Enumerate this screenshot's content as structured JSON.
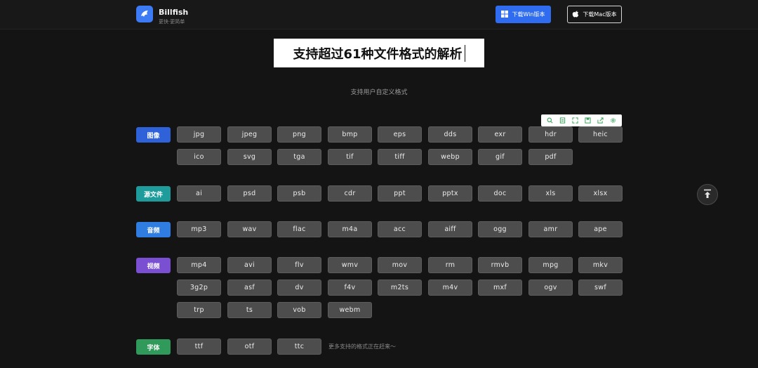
{
  "header": {
    "brand_name": "Billfish",
    "brand_tagline": "更快·更简单",
    "win_button": "下载Win版本",
    "mac_button": "下载Mac版本"
  },
  "hero": {
    "title": "支持超过61种文件格式的解析",
    "subtitle": "支持用户自定义格式"
  },
  "toolbar_icons": [
    "zoom-icon",
    "document-icon",
    "expand-icon",
    "save-icon",
    "share-icon",
    "settings-icon"
  ],
  "categories": [
    {
      "label": "图像",
      "color": "#2f62d8",
      "formats": [
        "jpg",
        "jpeg",
        "png",
        "bmp",
        "eps",
        "dds",
        "exr",
        "hdr",
        "heic",
        "ico",
        "svg",
        "tga",
        "tif",
        "tiff",
        "webp",
        "gif",
        "pdf"
      ]
    },
    {
      "label": "源文件",
      "color": "#1e9b9b",
      "formats": [
        "ai",
        "psd",
        "psb",
        "cdr",
        "ppt",
        "pptx",
        "doc",
        "xls",
        "xlsx"
      ]
    },
    {
      "label": "音频",
      "color": "#2f7de0",
      "formats": [
        "mp3",
        "wav",
        "flac",
        "m4a",
        "acc",
        "aiff",
        "ogg",
        "amr",
        "ape"
      ]
    },
    {
      "label": "视频",
      "color": "#7a4fd1",
      "formats": [
        "mp4",
        "avi",
        "flv",
        "wmv",
        "mov",
        "rm",
        "rmvb",
        "mpg",
        "mkv",
        "3g2p",
        "asf",
        "dv",
        "f4v",
        "m2ts",
        "m4v",
        "mxf",
        "ogv",
        "swf",
        "trp",
        "ts",
        "vob",
        "webm"
      ]
    },
    {
      "label": "字体",
      "color": "#2f9a5a",
      "formats": [
        "ttf",
        "otf",
        "ttc"
      ]
    }
  ],
  "more_note": "更多支持的格式正在赶来～",
  "colors": {
    "accent": "#2f6cf0",
    "background": "#141414",
    "chip": "#4d4d4d"
  }
}
